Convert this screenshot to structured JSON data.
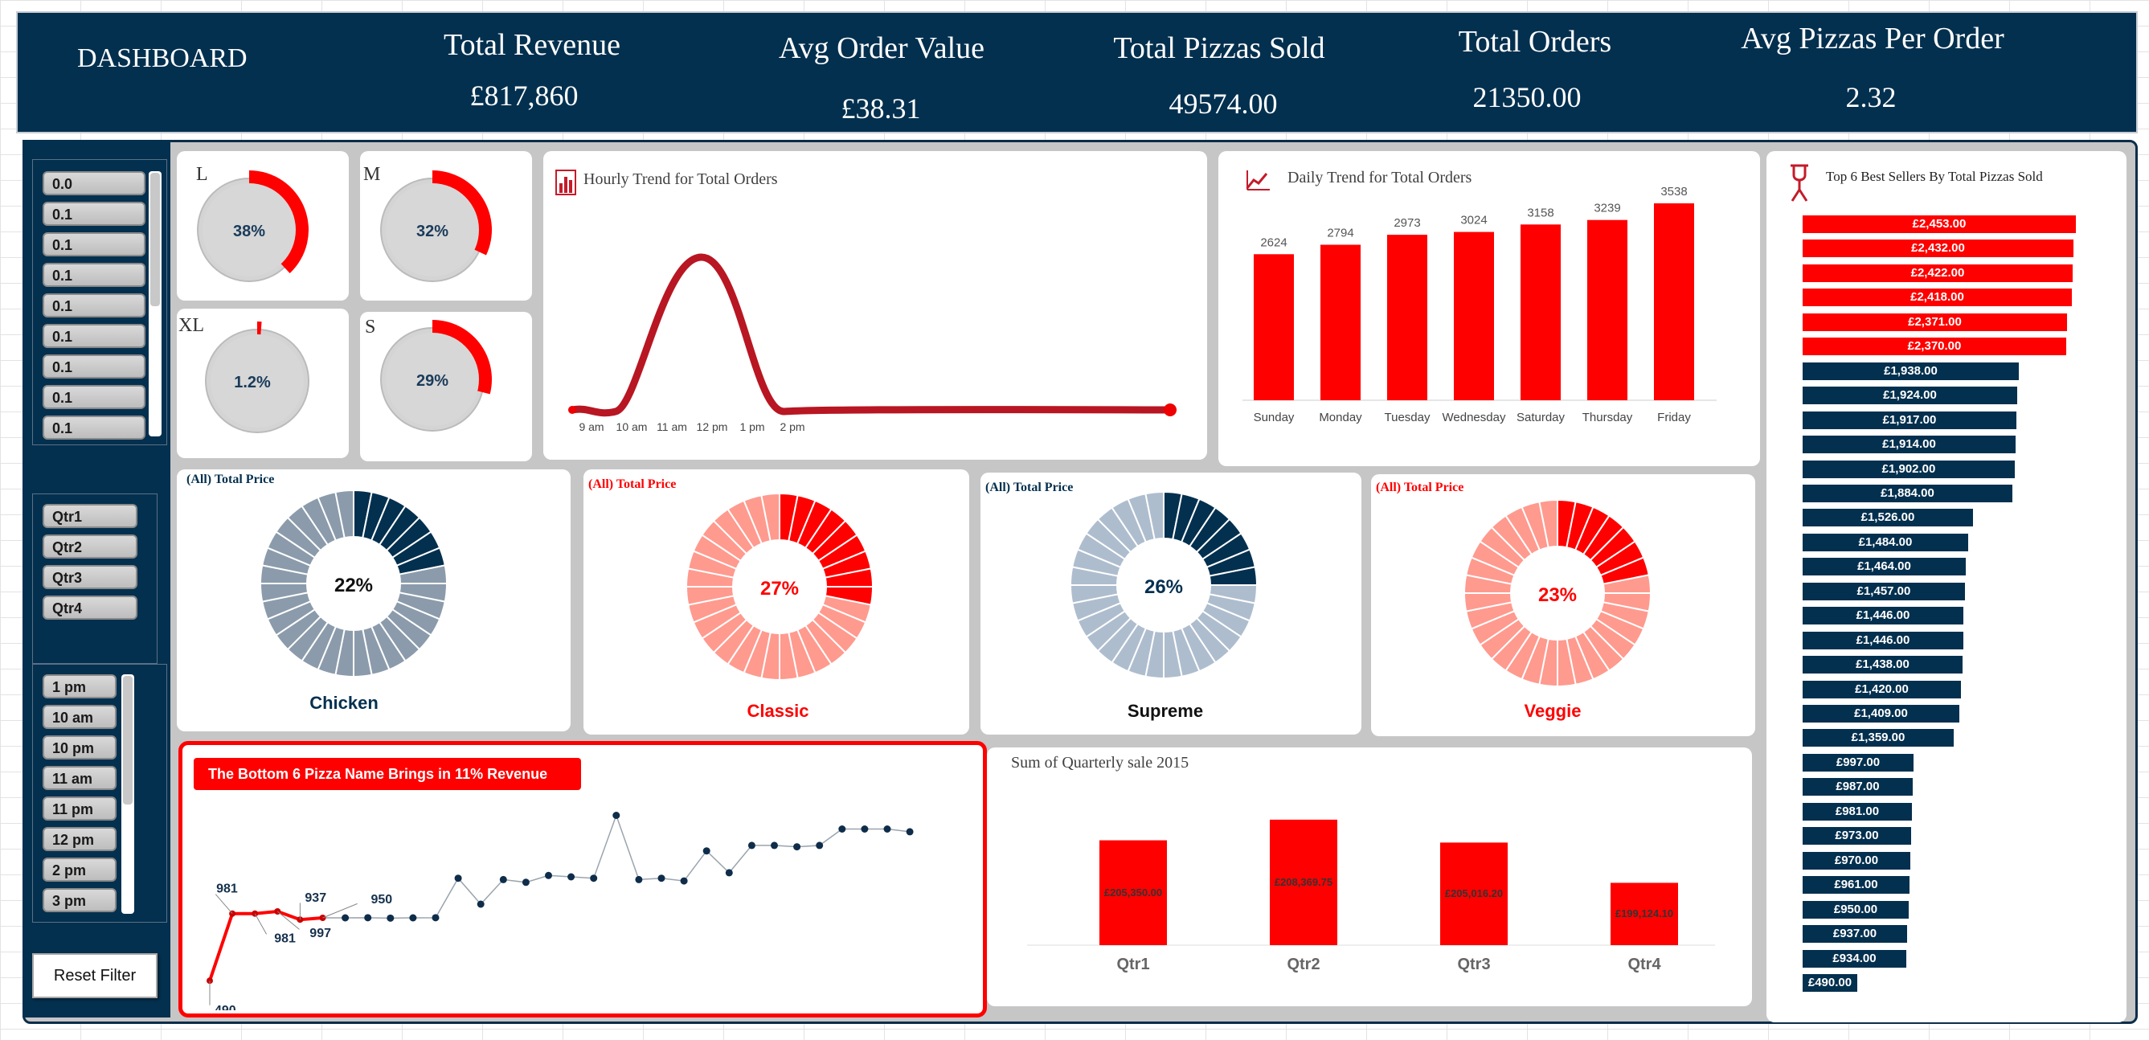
{
  "header": {
    "title": "DASHBOARD",
    "kpis": [
      {
        "label": "Total Revenue",
        "value": "£817,860"
      },
      {
        "label": "Avg  Order Value",
        "value": "£38.31"
      },
      {
        "label": "Total Pizzas Sold",
        "value": "49574.00"
      },
      {
        "label": "Total Orders",
        "value": "21350.00"
      },
      {
        "label": "Avg Pizzas Per Order",
        "value": "2.32"
      }
    ]
  },
  "slicers": {
    "values": [
      "0.0",
      "0.1",
      "0.1",
      "0.1",
      "0.1",
      "0.1",
      "0.1",
      "0.1",
      "0.1"
    ],
    "quarters": [
      "Qtr1",
      "Qtr2",
      "Qtr3",
      "Qtr4"
    ],
    "hours": [
      "1 pm",
      "10 am",
      "10 pm",
      "11 am",
      "11 pm",
      "12 pm",
      "2 pm",
      "3 pm"
    ],
    "reset_label": "Reset Filter"
  },
  "size_pies": [
    {
      "size": "L",
      "label": "38%",
      "fraction": 0.38
    },
    {
      "size": "M",
      "label": "32%",
      "fraction": 0.32
    },
    {
      "size": "XL",
      "label": "1.2%",
      "fraction": 0.012
    },
    {
      "size": "S",
      "label": "29%",
      "fraction": 0.29
    }
  ],
  "hourly": {
    "title": "Hourly Trend for Total Orders",
    "x_labels": [
      "9 am",
      "10 am",
      "11 am",
      "12 pm",
      "1 pm",
      "2 pm"
    ]
  },
  "daily": {
    "title": "Daily Trend for Total Orders"
  },
  "categories": {
    "header": "(All) Total Price",
    "items": [
      {
        "name": "Chicken",
        "label": "22%",
        "fraction": 0.22
      },
      {
        "name": "Classic",
        "label": "27%",
        "fraction": 0.27
      },
      {
        "name": "Supreme",
        "label": "26%",
        "fraction": 0.26
      },
      {
        "name": "Veggie",
        "label": "23%",
        "fraction": 0.23
      }
    ]
  },
  "bottom": {
    "title": "The Bottom 6 Pizza Name Brings in  11%  Revenue",
    "labels": [
      "490",
      "981",
      "981",
      "997",
      "937",
      "950"
    ]
  },
  "quarterly": {
    "title": "Sum of Quarterly sale 2015"
  },
  "best": {
    "title": "Top 6 Best Sellers By Total Pizzas Sold",
    "labels": [
      "£2,453.00",
      "£2,432.00",
      "£2,422.00",
      "£2,418.00",
      "£2,371.00",
      "£2,370.00",
      "£1,938.00",
      "£1,924.00",
      "£1,917.00",
      "£1,914.00",
      "£1,902.00",
      "£1,884.00",
      "£1,526.00",
      "£1,484.00",
      "£1,464.00",
      "£1,457.00",
      "£1,446.00",
      "£1,446.00",
      "£1,438.00",
      "£1,420.00",
      "£1,409.00",
      "£1,359.00",
      "£997.00",
      "£987.00",
      "£981.00",
      "£973.00",
      "£970.00",
      "£961.00",
      "£950.00",
      "£937.00",
      "£934.00",
      "£490.00"
    ],
    "values": [
      2453,
      2432,
      2422,
      2418,
      2371,
      2370,
      1938,
      1924,
      1917,
      1914,
      1902,
      1884,
      1526,
      1484,
      1464,
      1457,
      1446,
      1446,
      1438,
      1420,
      1409,
      1359,
      997,
      987,
      981,
      973,
      970,
      961,
      950,
      937,
      934,
      490
    ]
  },
  "colors": {
    "navy": "#04304f",
    "red": "#ff0000",
    "grey": "#c6c6c6"
  },
  "chart_data": [
    {
      "type": "bar",
      "title": "Daily Trend for Total Orders",
      "categories": [
        "Sunday",
        "Monday",
        "Tuesday",
        "Wednesday",
        "Saturday",
        "Thursday",
        "Friday"
      ],
      "values": [
        2624,
        2794,
        2973,
        3024,
        3158,
        3239,
        3538
      ],
      "tick_labels": [
        "Sunday",
        "Monday",
        "Tuesday",
        "Wednesday",
        "Saturday",
        "Thursday",
        "Friday"
      ],
      "value_labels": [
        "2624",
        "2794",
        "2973",
        "3024",
        "3158",
        "3239",
        "3538"
      ]
    },
    {
      "type": "bar",
      "title": "Sum of Quarterly sale 2015",
      "categories": [
        "Qtr1",
        "Qtr2",
        "Qtr3",
        "Qtr4"
      ],
      "values": [
        205350.0,
        208369.75,
        205016.2,
        199124.1
      ],
      "tick_labels": [
        "Qtr1",
        "Qtr2",
        "Qtr3",
        "Qtr4"
      ],
      "value_labels": [
        "£205,350.00",
        "£208,369.75",
        "£205,016.20",
        "£199,124.10"
      ]
    },
    {
      "type": "line",
      "title": "The Bottom 6 Pizza Name Brings in  11%  Revenue",
      "values": [
        490,
        981,
        981,
        997,
        937,
        950,
        950,
        951,
        948,
        950,
        951,
        1240,
        1050,
        1230,
        1210,
        1260,
        1250,
        1240,
        1700,
        1230,
        1240,
        1220,
        1440,
        1280,
        1480,
        1480,
        1470,
        1480,
        1600,
        1600,
        1600,
        1580
      ]
    },
    {
      "type": "area",
      "title": "Hourly Trend for Total Orders",
      "x": [
        "9 am",
        "10 am",
        "11 am",
        "12 pm",
        "1 pm",
        "2 pm"
      ],
      "y": [
        0,
        0,
        0.72,
        1.0,
        0.25,
        0
      ]
    }
  ]
}
